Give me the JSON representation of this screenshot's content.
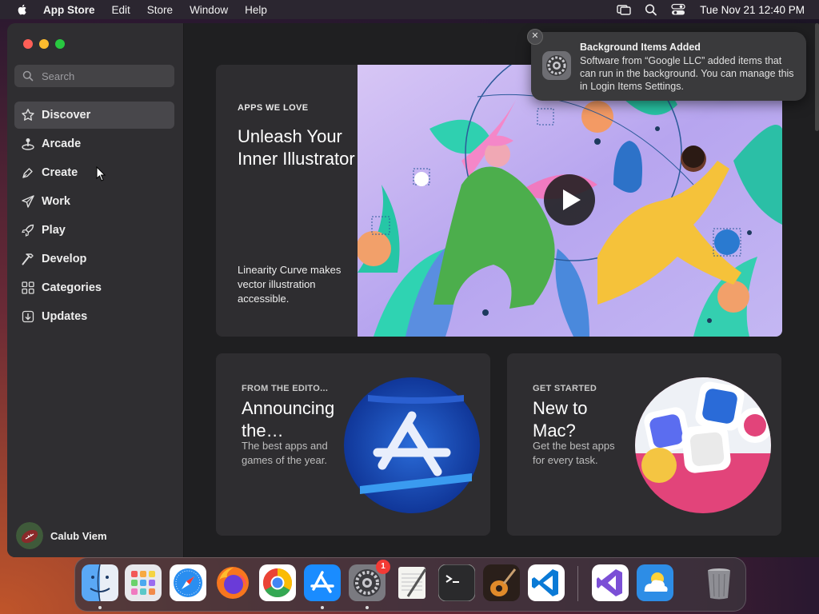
{
  "menubar": {
    "app_name": "App Store",
    "menus": [
      "Edit",
      "Store",
      "Window",
      "Help"
    ],
    "clock": "Tue Nov 21  12:40 PM"
  },
  "sidebar": {
    "search_placeholder": "Search",
    "items": [
      {
        "label": "Discover",
        "icon": "star-icon",
        "active": true
      },
      {
        "label": "Arcade",
        "icon": "joystick-icon"
      },
      {
        "label": "Create",
        "icon": "pen-icon"
      },
      {
        "label": "Work",
        "icon": "paper-plane-icon"
      },
      {
        "label": "Play",
        "icon": "rocket-icon"
      },
      {
        "label": "Develop",
        "icon": "hammer-icon"
      },
      {
        "label": "Categories",
        "icon": "grid-icon"
      },
      {
        "label": "Updates",
        "icon": "download-icon"
      }
    ],
    "profile_name": "Calub Viem"
  },
  "hero": {
    "eyebrow": "APPS WE LOVE",
    "title": "Unleash Your Inner Illustrator",
    "description": "Linearity Curve makes vector illustration accessible."
  },
  "cards": [
    {
      "eyebrow": "FROM THE EDITO...",
      "title": "Announcing the…",
      "description": "The best apps and games of the year."
    },
    {
      "eyebrow": "GET STARTED",
      "title": "New to Mac?",
      "description": "Get the best apps for every task."
    }
  ],
  "notification": {
    "title": "Background Items Added",
    "body": "Software from “Google LLC” added items that can run in the background. You can manage this in Login Items Settings.",
    "close": "✕"
  },
  "dock": {
    "apps": [
      "finder",
      "launchpad",
      "safari",
      "firefox",
      "chrome",
      "app-store",
      "system-settings",
      "textedit",
      "terminal",
      "garageband",
      "vscode",
      "visual-studio",
      "weather",
      "trash"
    ],
    "settings_badge": "1"
  },
  "colors": {
    "window_bg": "#232325",
    "sidebar_bg": "#2f2e31",
    "card_bg": "#2e2d30",
    "accent_blue": "#0a84ff"
  }
}
